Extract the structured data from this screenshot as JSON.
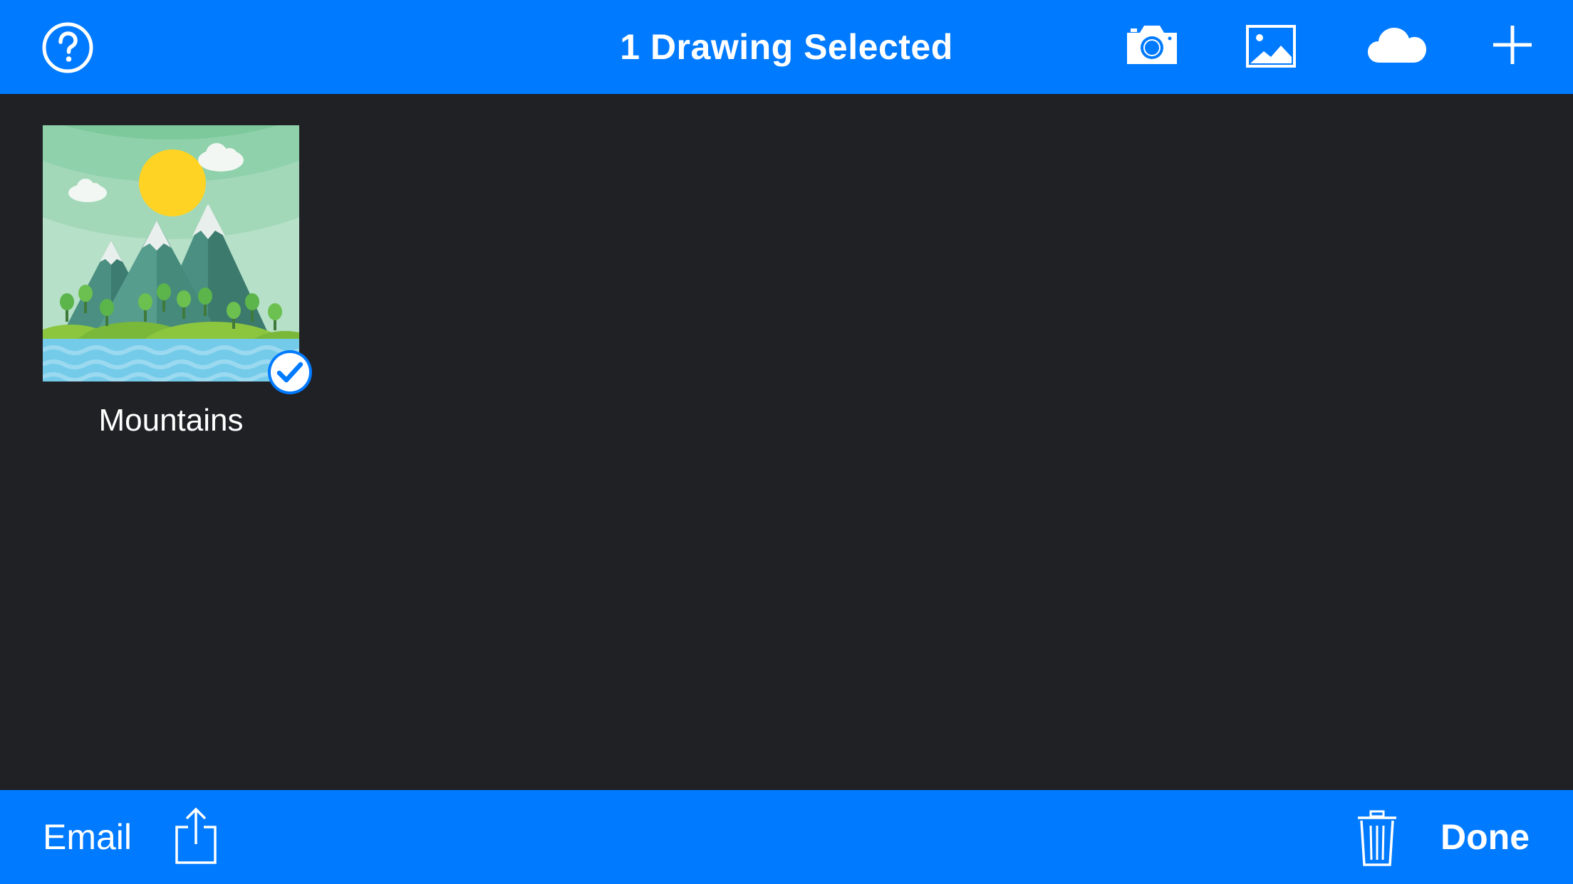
{
  "header": {
    "title": "1 Drawing Selected",
    "icons": {
      "help": "question-circle-icon",
      "camera": "camera-icon",
      "photos": "photo-library-icon",
      "cloud": "cloud-icon",
      "add": "plus-icon"
    }
  },
  "gallery": {
    "items": [
      {
        "name": "Mountains",
        "selected": true,
        "thumbnail": "mountain-landscape-thumbnail"
      }
    ]
  },
  "toolbar": {
    "email_label": "Email",
    "done_label": "Done",
    "icons": {
      "share": "share-icon",
      "trash": "trash-icon"
    }
  },
  "colors": {
    "accent": "#007aff",
    "background": "#202125",
    "text": "#ffffff"
  }
}
